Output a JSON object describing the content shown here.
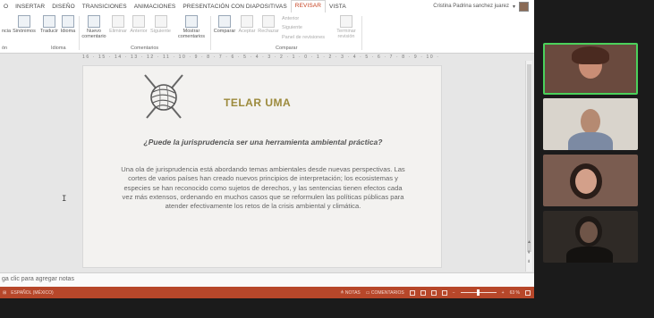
{
  "tabs": [
    "O",
    "INSERTAR",
    "DISEÑO",
    "TRANSICIONES",
    "ANIMACIONES",
    "PRESENTACIÓN CON DIAPOSITIVAS",
    "REVISAR",
    "VISTA"
  ],
  "active_tab": "REVISAR",
  "user_name": "Cristina Padrina sanchez juarez",
  "ribbon": {
    "cia_label": "ncia",
    "sinonimos": "Sinónimos",
    "traducir": "Traducir",
    "idioma": "Idioma",
    "nuevo_comentario": "Nuevo comentario",
    "eliminar": "Eliminar",
    "anterior": "Anterior",
    "siguiente": "Siguiente",
    "mostrar_comentarios": "Mostrar comentarios",
    "comparar": "Comparar",
    "aceptar": "Aceptar",
    "rechazar": "Rechazar",
    "anterior_small": "Anterior",
    "siguiente_small": "Siguiente",
    "panel_revisiones": "Panel de revisiones",
    "terminar_revision": "Terminar revisión",
    "group_on": "ón",
    "group_idioma": "Idioma",
    "group_comentarios": "Comentarios",
    "group_comparar": "Comparar"
  },
  "ruler": "16 · 15 · 14 · 13 · 12 · 11 · 10 · 9 · 8 · 7 · 6 · 5 · 4 · 3 · 2 · 1 · 0 · 1 · 2 · 3 · 4 · 5 · 6 · 7 · 8 · 9 · 10 · 11 · 12 · 13 · 14 · 15 · 16",
  "slide": {
    "title": "TELAR UMA",
    "question": "¿Puede la jurisprudencia ser una herramienta ambiental práctica?",
    "body": "Una ola de jurisprudencia está abordando temas ambientales desde nuevas perspectivas. Las cortes de varios países han creado nuevos principios de interpretación; los ecosistemas y especies se han reconocido como sujetos de derechos, y las sentencias tienen efectos cada vez más extensos, ordenando en muchos casos que se reformulen las políticas públicas para atender efectivamente los retos de la crisis ambiental y climática."
  },
  "notes_placeholder": "ga clic para agregar notas",
  "status": {
    "language": "ESPAÑOL (MÉXICO)",
    "notas": "NOTAS",
    "comentarios": "COMENTARIOS",
    "zoom": "63 %"
  },
  "colors": {
    "accent": "#b7472a",
    "title_gold": "#9c8a3c",
    "speaking_border": "#4bd15b"
  }
}
